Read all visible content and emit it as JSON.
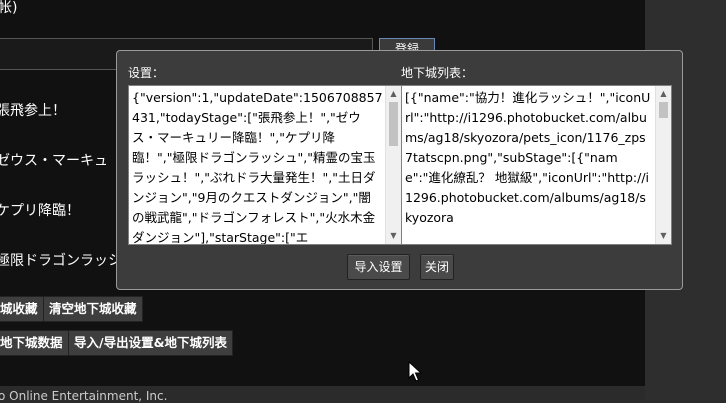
{
  "background_page": {
    "top_link": "帐)",
    "submit_button": "登録",
    "list_items": [
      "張飛参上！",
      "ゼウス・マーキュ",
      "ケプリ降臨！",
      "極限ドラゴンラッシ"
    ],
    "buttons_row1": [
      "城收藏",
      "清空地下城收藏"
    ],
    "buttons_row2": [
      "地下城数据",
      "导入/导出设置&地下城列表"
    ],
    "footer": "o Online Entertainment, Inc."
  },
  "modal": {
    "settings_label": "设置：",
    "settings_text": "{\"version\":1,\"updateDate\":1506708857431,\"todayStage\":[\"張飛参上！\",\"ゼウス・マーキュリー降臨！\",\"ケプリ降臨！\",\"極限ドラゴンラッシュ\",\"精霊の宝玉ラッシュ！\",\"ぶれドラ大量発生！\",\"土日ダンジョン\",\"9月のクエストダンジョン\",\"闇の戦武龍\",\"ドラゴンフォレスト\",\"火水木金ダンジョン\"],\"starStage\":[\"エ",
    "dungeon_label": "地下城列表：",
    "dungeon_text": "[{\"name\":\"協力！進化ラッシュ！\",\"iconUrl\":\"http://i1296.photobucket.com/albums/ag18/skyozora/pets_icon/1176_zps7tatscpn.png\",\"subStage\":[{\"name\":\"進化繚乱？ 地獄級\",\"iconUrl\":\"http://i1296.photobucket.com/albums/ag18/skyozora",
    "import_button": "导入设置",
    "close_button": "关闭"
  },
  "colors": {
    "modal_bg": "#3c3c3c",
    "page_bg": "#111111",
    "button_bg": "#3e3e3e"
  }
}
